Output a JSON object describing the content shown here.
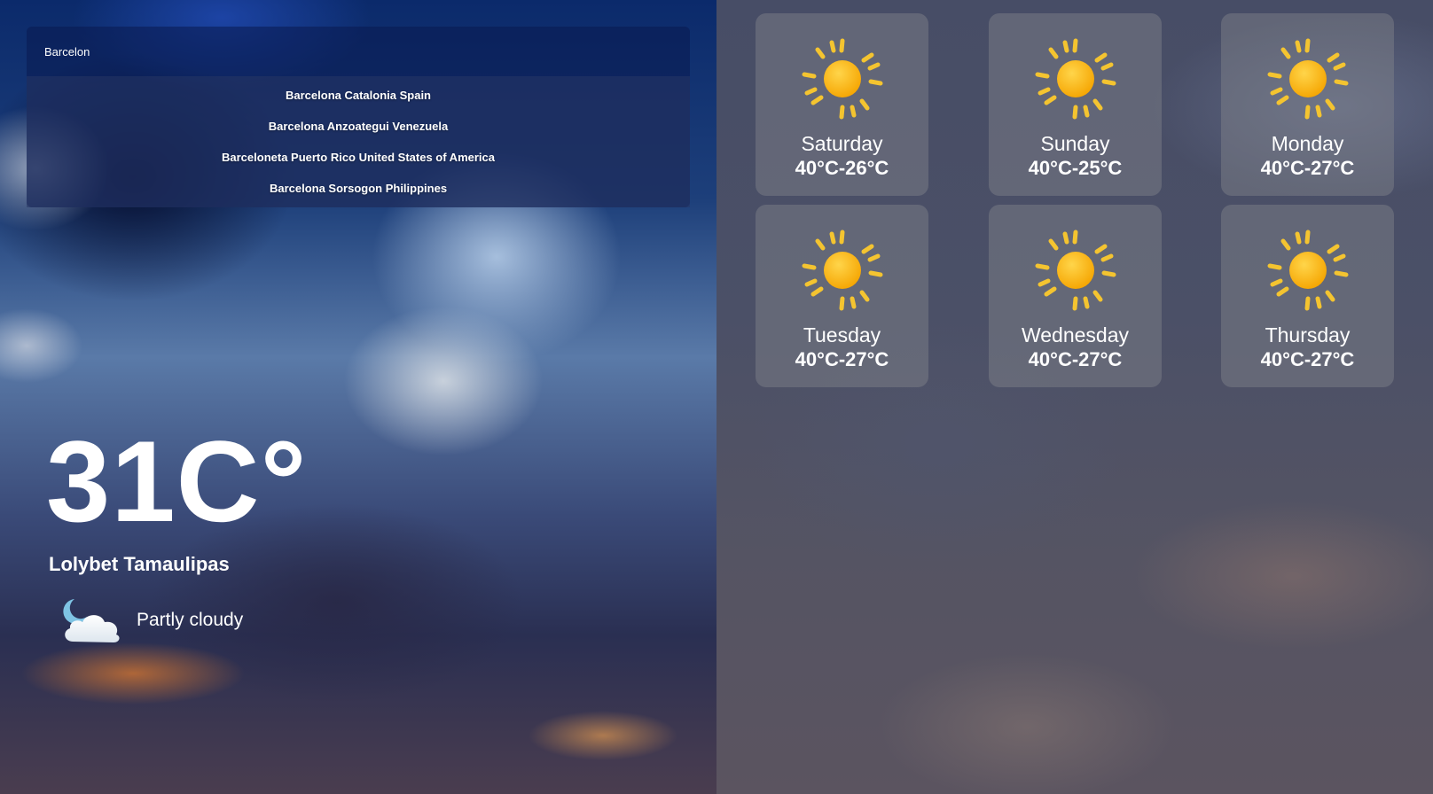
{
  "search": {
    "value": "Barcelon",
    "suggestions": [
      "Barcelona Catalonia Spain",
      "Barcelona Anzoategui Venezuela",
      "Barceloneta Puerto Rico United States of America",
      "Barcelona Sorsogon Philippines"
    ]
  },
  "current": {
    "temperature": "31C°",
    "location": "Lolybet Tamaulipas",
    "condition": "Partly cloudy",
    "condition_icon": "night-partly-cloudy-icon"
  },
  "forecast": [
    {
      "day": "Saturday",
      "range": "40°C-26°C",
      "icon": "sun-icon"
    },
    {
      "day": "Sunday",
      "range": "40°C-25°C",
      "icon": "sun-icon"
    },
    {
      "day": "Monday",
      "range": "40°C-27°C",
      "icon": "sun-icon"
    },
    {
      "day": "Tuesday",
      "range": "40°C-27°C",
      "icon": "sun-icon"
    },
    {
      "day": "Wednesday",
      "range": "40°C-27°C",
      "icon": "sun-icon"
    },
    {
      "day": "Thursday",
      "range": "40°C-27°C",
      "icon": "sun-icon"
    }
  ],
  "colors": {
    "sun": "#f7b21f",
    "sun_rays": "#f4c430",
    "card_bg": "#82848c"
  }
}
